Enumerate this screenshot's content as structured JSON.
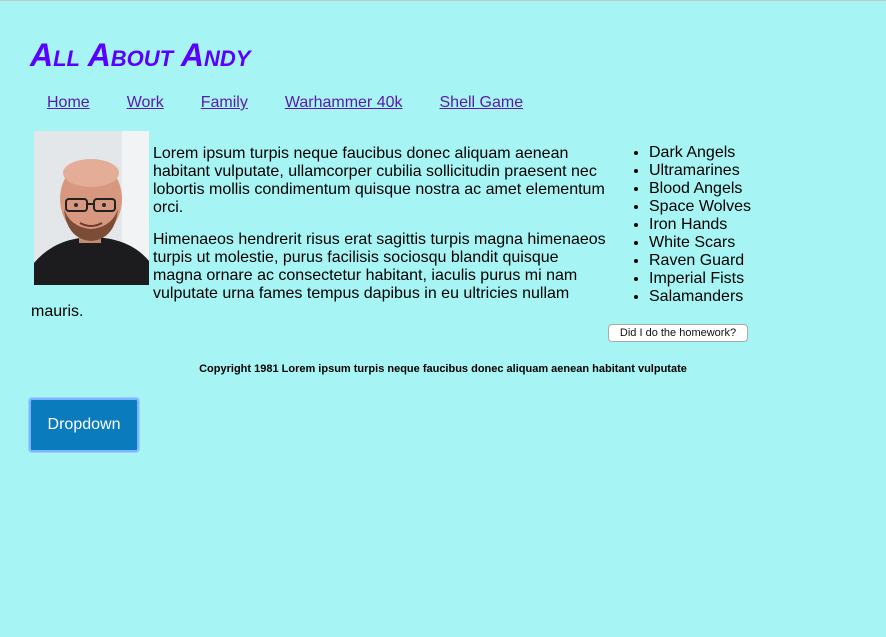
{
  "site": {
    "title": "All About Andy"
  },
  "nav": {
    "items": [
      "Home",
      "Work",
      "Family",
      "Warhammer 40k",
      "Shell Game"
    ]
  },
  "main": {
    "paragraphs": [
      "Lorem ipsum turpis neque faucibus donec aliquam aenean habitant vulputate, ullamcorper cubilia sollicitudin praesent nec lobortis mollis condimentum quisque nostra ac amet elementum orci.",
      "Himenaeos hendrerit risus erat sagittis turpis magna himenaeos turpis ut molestie, purus facilisis sociosqu blandit quisque magna ornare ac consectetur habitant, iaculis purus mi nam vulputate urna fames tempus dapibus in eu ultricies nullam mauris."
    ]
  },
  "legions": [
    "Dark Angels",
    "Ultramarines",
    "Blood Angels",
    "Space Wolves",
    "Iron Hands",
    "White Scars",
    "Raven Guard",
    "Imperial Fists",
    "Salamanders"
  ],
  "homework_button": "Did I do the homework?",
  "footer": {
    "text": "Copyright 1981 Lorem ipsum turpis neque faucibus donec aliquam aenean habitant vulputate"
  },
  "dropdown_button": "Dropdown",
  "colors": {
    "background": "#a7f4f4",
    "title": "#5a00ff",
    "link": "#5a1aa8",
    "dropdown": "#0a7bbd"
  }
}
